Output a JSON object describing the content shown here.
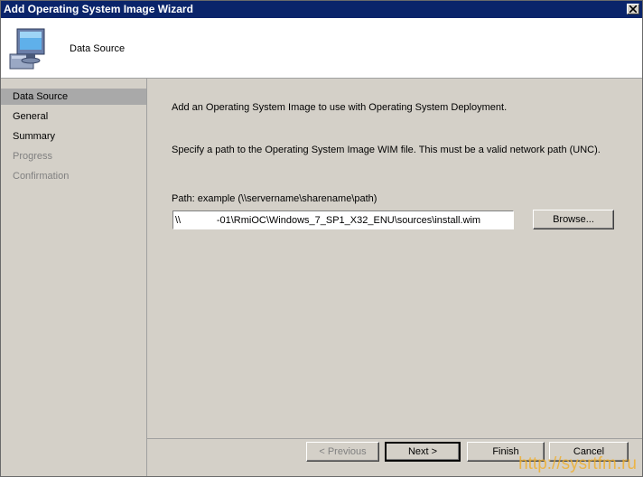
{
  "window": {
    "title": "Add Operating System Image Wizard"
  },
  "header": {
    "title": "Data Source",
    "icon": "computer-monitor-icon"
  },
  "sidebar": {
    "items": [
      {
        "label": "Data Source",
        "state": "selected"
      },
      {
        "label": "General",
        "state": "enabled"
      },
      {
        "label": "Summary",
        "state": "enabled"
      },
      {
        "label": "Progress",
        "state": "disabled"
      },
      {
        "label": "Confirmation",
        "state": "disabled"
      }
    ]
  },
  "main": {
    "intro": "Add an Operating System Image to use with Operating System Deployment.",
    "instructions": "Specify a path to the Operating System Image WIM file. This must be a valid network path (UNC).",
    "path_label": "Path: example (\\\\servername\\sharename\\path)",
    "path_value": "\\\\             -01\\RmiOC\\Windows_7_SP1_X32_ENU\\sources\\install.wim",
    "browse_label": "Browse..."
  },
  "footer": {
    "previous_label": "< Previous",
    "next_label": "Next >",
    "finish_label": "Finish",
    "cancel_label": "Cancel"
  },
  "watermark": "http://sysrtfm.ru",
  "colors": {
    "titlebar": "#0a246a",
    "selected_nav": "#a9a9a9",
    "watermark": "#f0b030"
  }
}
